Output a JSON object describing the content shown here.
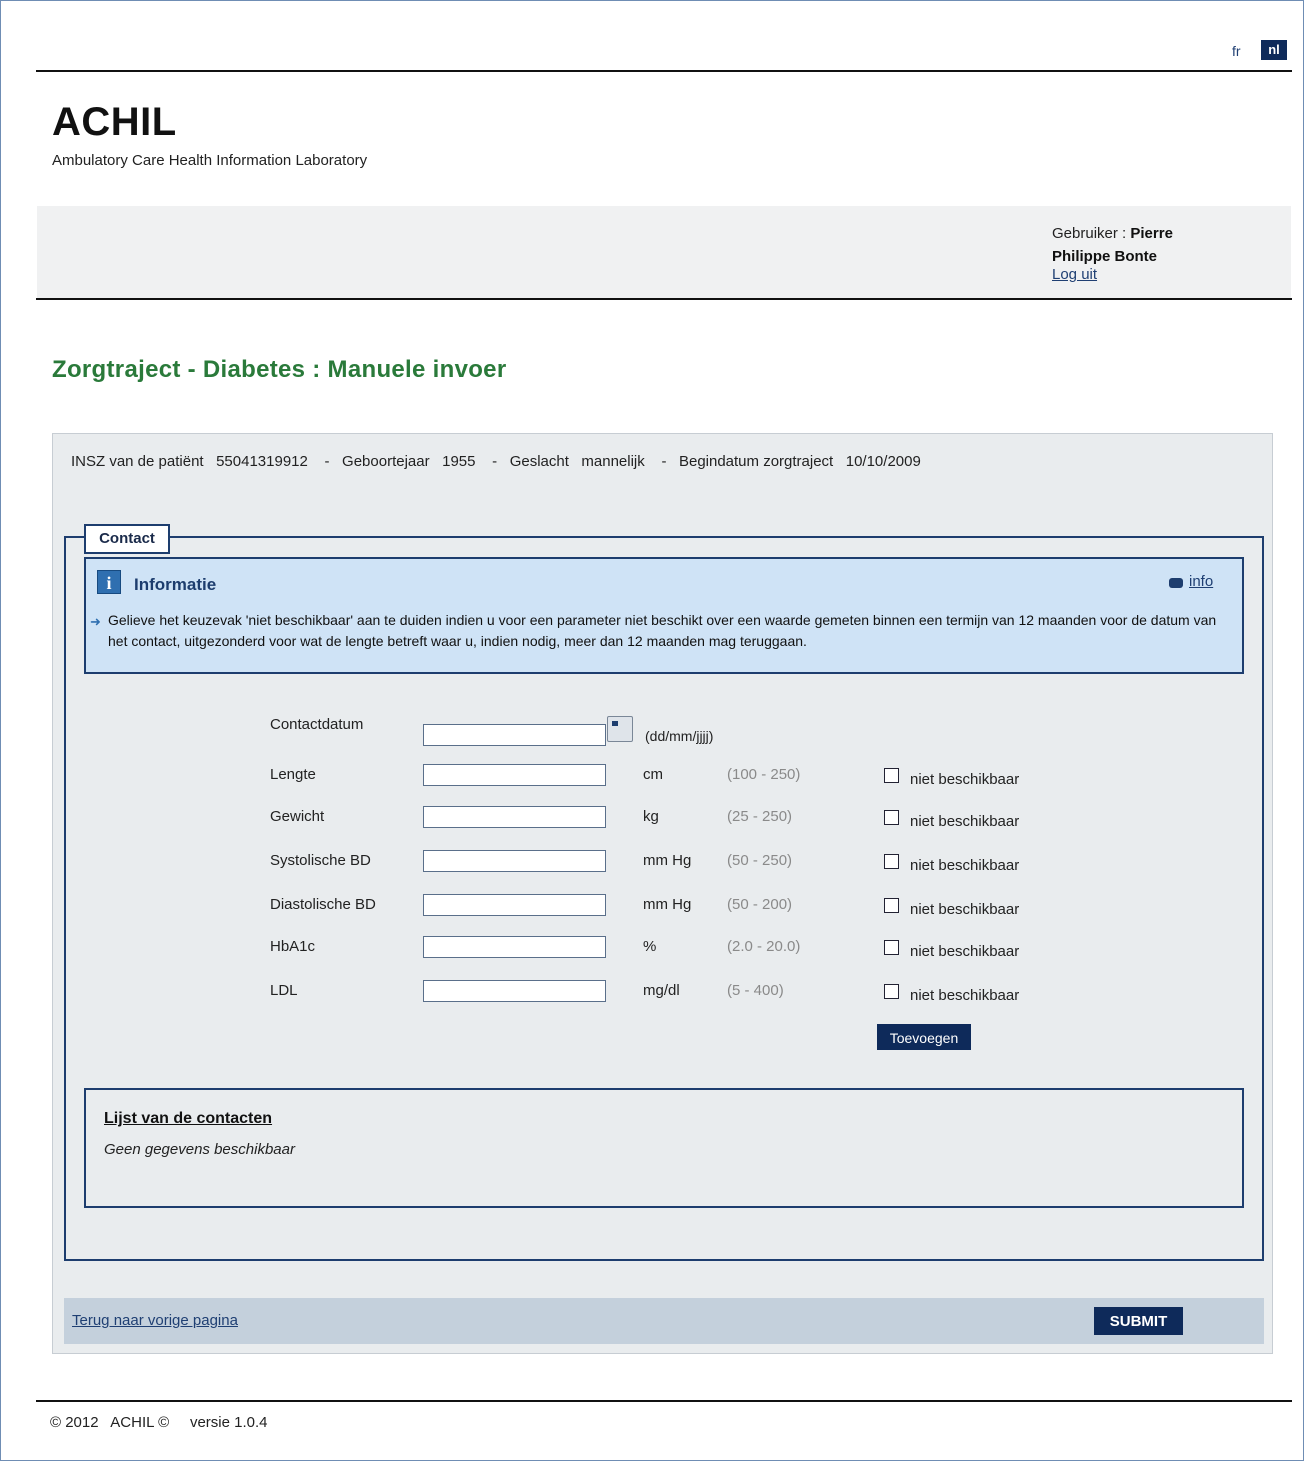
{
  "language": {
    "fr": "fr",
    "nl": "nl"
  },
  "brand": {
    "name": "ACHIL",
    "subtitle": "Ambulatory Care Health Information Laboratory"
  },
  "user": {
    "label": "Gebruiker :",
    "first": "Pierre",
    "full": "Philippe Bonte",
    "logout": "Log uit"
  },
  "page": {
    "title": "Zorgtraject - Diabetes : Manuele invoer"
  },
  "patient": {
    "insz_label": "INSZ van de patiënt",
    "insz": "55041319912",
    "birth_label": "Geboortejaar",
    "birth": "1955",
    "sex_label": "Geslacht",
    "sex": "mannelijk",
    "start_label": "Begindatum zorgtraject",
    "start": "10/10/2009",
    "sep": "-"
  },
  "contact": {
    "legend": "Contact",
    "info": {
      "title": "Informatie",
      "link": "info",
      "text": "Gelieve het keuzevak 'niet beschikbaar' aan te duiden indien u voor een parameter niet beschikt over een waarde gemeten binnen een termijn van 12 maanden voor de datum van het contact, uitgezonderd voor wat de lengte betreft waar u, indien nodig, meer dan 12 maanden mag teruggaan."
    },
    "date": {
      "label": "Contactdatum",
      "format": "(dd/mm/jjjj)",
      "value": ""
    },
    "fields": [
      {
        "label": "Lengte",
        "unit": "cm",
        "range": "(100 - 250)",
        "value": "",
        "na_label": "niet beschikbaar",
        "na_checked": false
      },
      {
        "label": "Gewicht",
        "unit": "kg",
        "range": "(25 - 250)",
        "value": "",
        "na_label": "niet beschikbaar",
        "na_checked": false
      },
      {
        "label": "Systolische BD",
        "unit": "mm Hg",
        "range": "(50 - 250)",
        "value": "",
        "na_label": "niet beschikbaar",
        "na_checked": false
      },
      {
        "label": "Diastolische BD",
        "unit": "mm Hg",
        "range": "(50 - 200)",
        "value": "",
        "na_label": "niet beschikbaar",
        "na_checked": false
      },
      {
        "label": "HbA1c",
        "unit": "%",
        "range": "(2.0 - 20.0)",
        "value": "",
        "na_label": "niet beschikbaar",
        "na_checked": false
      },
      {
        "label": "LDL",
        "unit": "mg/dl",
        "range": "(5 - 400)",
        "value": "",
        "na_label": "niet beschikbaar",
        "na_checked": false
      }
    ],
    "add_button": "Toevoegen",
    "list": {
      "title": "Lijst van de contacten",
      "empty": "Geen gegevens beschikbaar"
    }
  },
  "actions": {
    "back": "Terug naar vorige pagina",
    "submit": "SUBMIT"
  },
  "footer": {
    "copyright": "© 2012",
    "brand": "ACHIL ©",
    "version": "versie 1.0.4"
  },
  "colors": {
    "title_green": "#2a7a3a",
    "navy": "#0e2a5a",
    "info_bg": "#cfe3f6"
  }
}
